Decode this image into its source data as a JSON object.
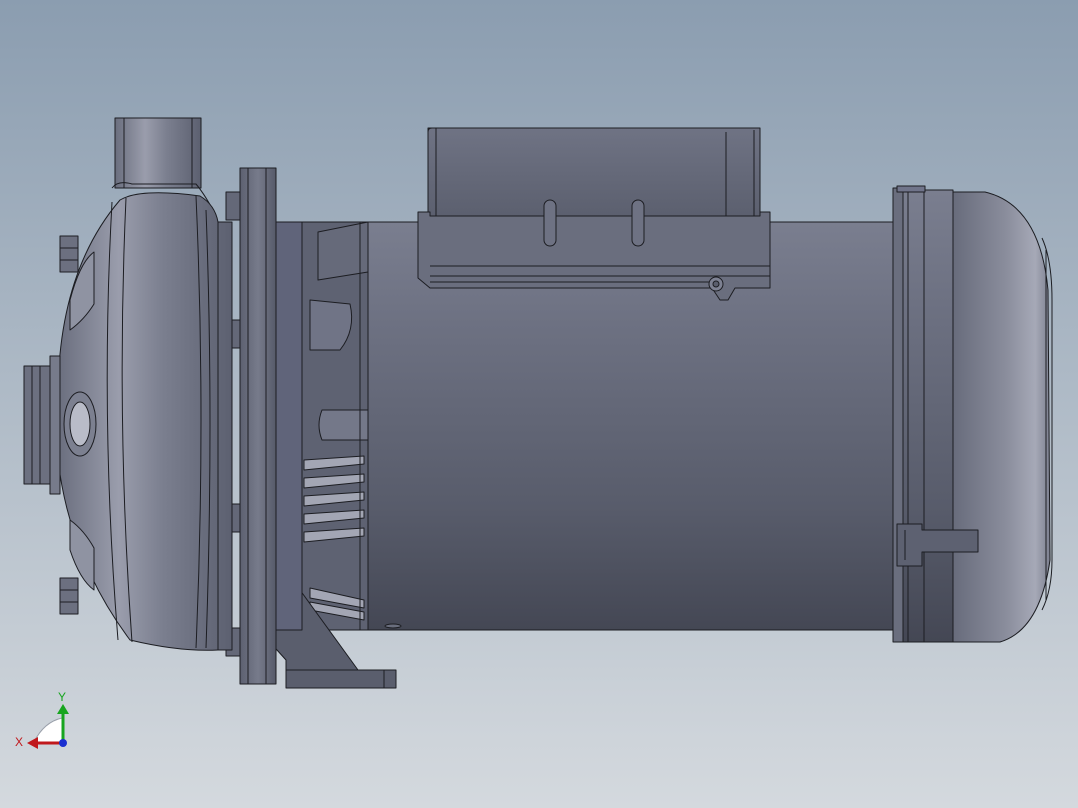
{
  "viewport": {
    "background_top": "#8b9db0",
    "background_bottom": "#d4d9de"
  },
  "model": {
    "body_color": "#5f6373",
    "edge_color": "#1c1d22",
    "highlight_color": "#b4b7c5",
    "shadow_color": "#3c3f4b"
  },
  "triad": {
    "x_label": "X",
    "y_label": "Y",
    "x_color": "#c0181c",
    "y_color": "#17a51f",
    "z_color": "#1a2fd0"
  }
}
